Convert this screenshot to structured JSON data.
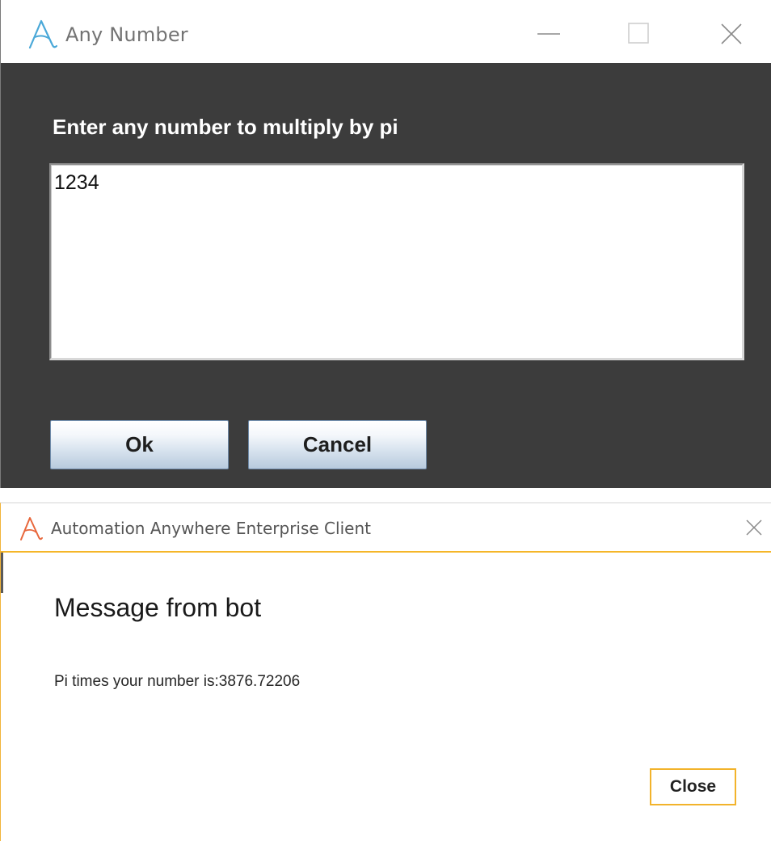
{
  "input_dialog": {
    "title": "Any Number",
    "prompt": "Enter any number to multiply by pi",
    "input_value": "1234",
    "ok_label": "Ok",
    "cancel_label": "Cancel",
    "icons": {
      "app": "automation-anywhere-logo-icon",
      "minimize": "minimize-icon",
      "maximize": "maximize-icon",
      "close": "close-icon"
    },
    "colors": {
      "body_background": "#3c3c3c",
      "logo": "#4aa8d8"
    }
  },
  "message_dialog": {
    "title": "Automation Anywhere Enterprise Client",
    "heading": "Message from bot",
    "message": "Pi times your number is:3876.72206",
    "close_button_label": "Close",
    "icons": {
      "app": "automation-anywhere-logo-icon",
      "close": "close-icon"
    },
    "colors": {
      "accent": "#f5b629",
      "logo": "#e8673c"
    }
  }
}
